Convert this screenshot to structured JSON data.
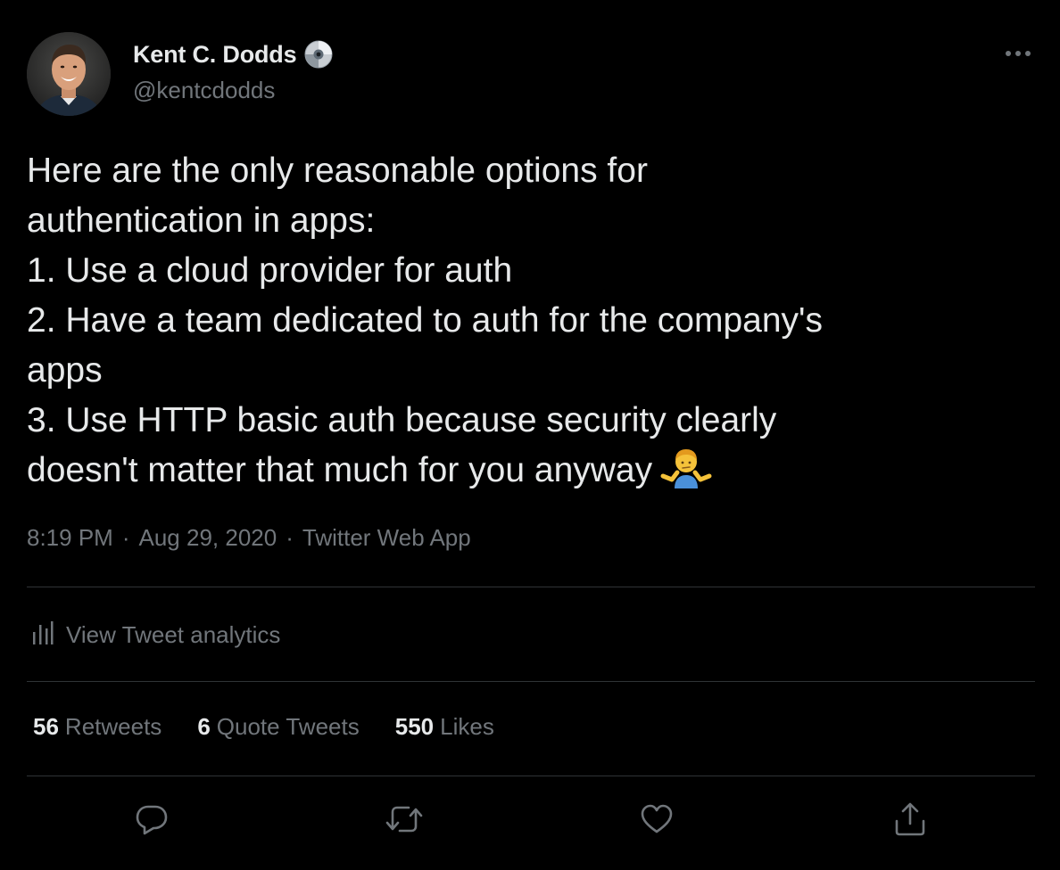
{
  "author": {
    "display_name": "Kent C. Dodds",
    "handle": "@kentcdodds",
    "badge_icon": "disc-icon"
  },
  "tweet": {
    "lines": [
      "Here are the only reasonable options for",
      "authentication in apps:",
      "1. Use a cloud provider for auth",
      "2. Have a team dedicated to auth for the company's",
      "apps",
      "3. Use HTTP basic auth because security clearly",
      "doesn't matter that much for you anyway"
    ],
    "trailing_emoji": "person-shrugging-emoji"
  },
  "meta": {
    "time": "8:19 PM",
    "separator": "·",
    "date": "Aug 29, 2020",
    "source": "Twitter Web App"
  },
  "analytics": {
    "label": "View Tweet analytics",
    "icon": "bar-chart-icon"
  },
  "stats": {
    "retweets": {
      "count": "56",
      "label": "Retweets"
    },
    "quotes": {
      "count": "6",
      "label": "Quote Tweets"
    },
    "likes": {
      "count": "550",
      "label": "Likes"
    }
  },
  "actions": {
    "reply_icon": "reply-icon",
    "retweet_icon": "retweet-icon",
    "like_icon": "heart-icon",
    "share_icon": "share-icon"
  },
  "colors": {
    "background": "#000000",
    "primary_text": "#e7e9ea",
    "secondary_text": "#71767b",
    "divider": "#2f3336"
  }
}
